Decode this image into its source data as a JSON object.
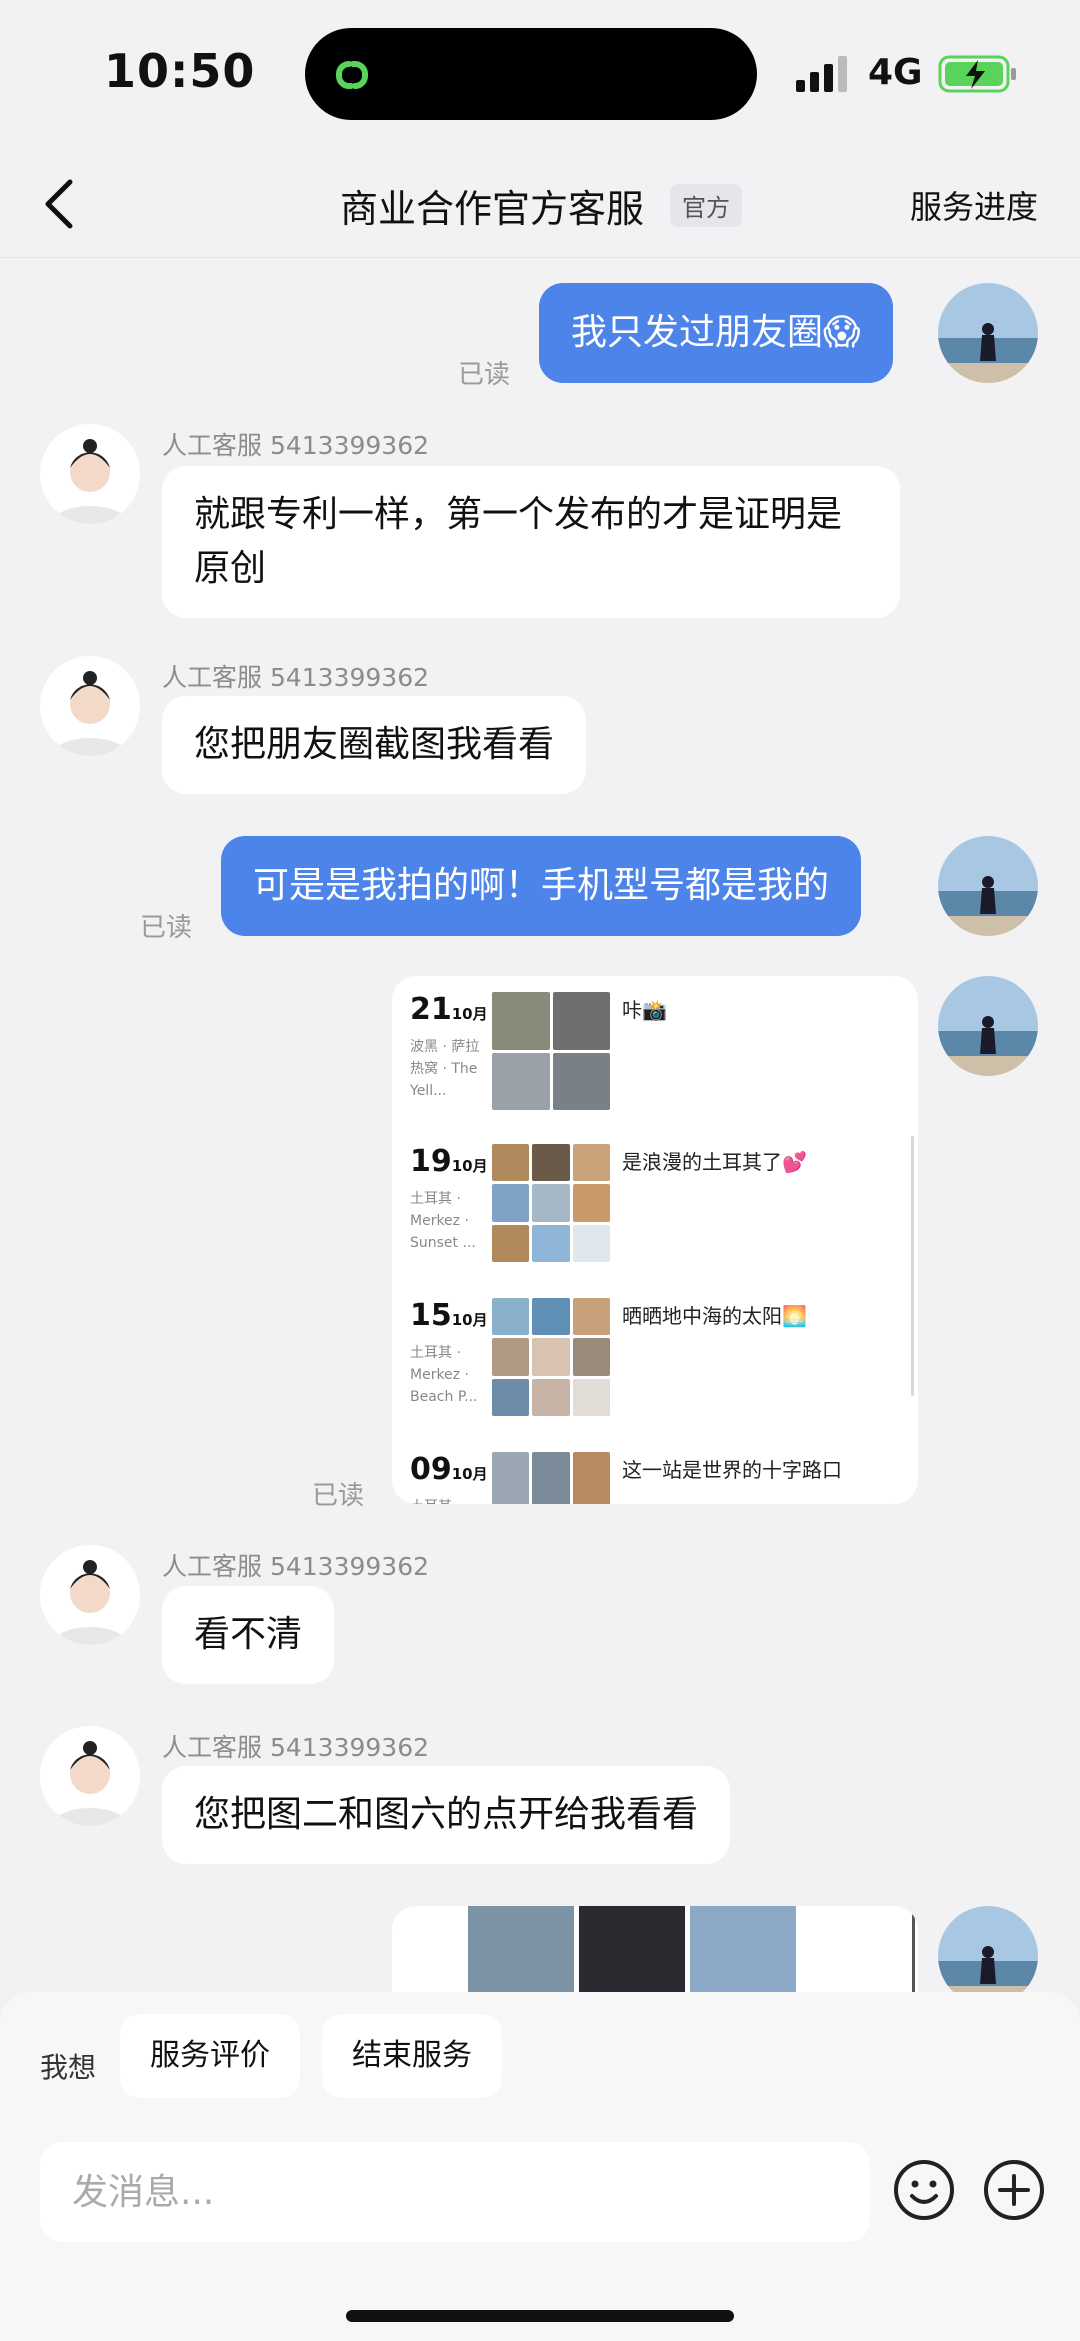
{
  "status_bar": {
    "time": "10:50",
    "network": "4G"
  },
  "header": {
    "title": "商业合作官方客服",
    "badge": "官方",
    "right_action": "服务进度"
  },
  "messages": {
    "m1": {
      "text": "我只发过朋友圈😱",
      "read": "已读"
    },
    "m2": {
      "agent": "人工客服 5413399362",
      "text": "就跟专利一样，第一个发布的才是证明是原创"
    },
    "m3": {
      "agent": "人工客服 5413399362",
      "text": "您把朋友圈截图我看看"
    },
    "m4": {
      "text": "可是是我拍的啊！手机型号都是我的",
      "read": "已读"
    },
    "m5": {
      "read": "已读",
      "posts": [
        {
          "day": "21",
          "month": "10月",
          "location": "波黑 · 萨拉热窝 · The Yell...",
          "caption": "咔📸"
        },
        {
          "day": "19",
          "month": "10月",
          "location": "土耳其 · Merkez · Sunset ...",
          "caption": "是浪漫的土耳其了💕"
        },
        {
          "day": "15",
          "month": "10月",
          "location": "土耳其 · Merkez · Beach P...",
          "caption": "晒晒地中海的太阳🌅"
        },
        {
          "day": "09",
          "month": "10月",
          "location": "土耳其 ·",
          "caption": "这一站是世界的十字路口"
        }
      ]
    },
    "m6": {
      "agent": "人工客服 5413399362",
      "text": "看不清"
    },
    "m7": {
      "agent": "人工客服 5413399362",
      "text": "您把图二和图六的点开给我看看"
    }
  },
  "bottom": {
    "want_label": "我想",
    "chips": [
      "服务评价",
      "结束服务"
    ],
    "input_placeholder": "发消息..."
  },
  "colors": {
    "bubble_outgoing": "#4c84ea",
    "background": "#f2f2f4",
    "island": "#000000",
    "battery": "#5ad35a"
  }
}
